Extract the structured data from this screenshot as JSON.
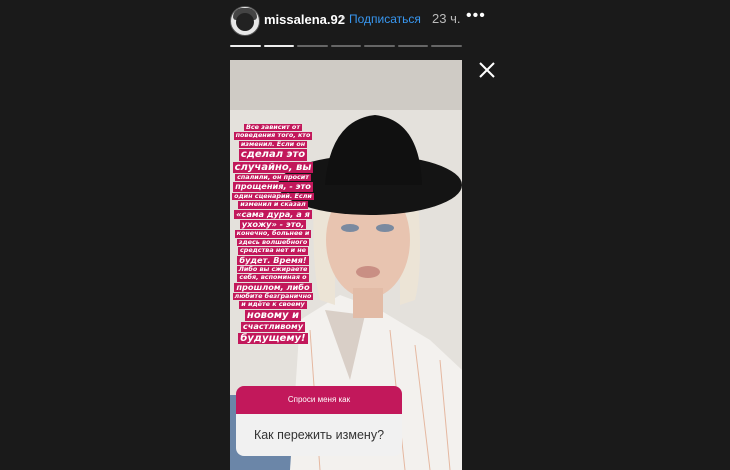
{
  "header": {
    "username": "missalena.92",
    "separator": "•",
    "subscribe_label": "Подписаться",
    "time": "23 ч.",
    "more_label": "•••"
  },
  "progress": {
    "total": 7,
    "completed": 2
  },
  "story": {
    "sticker_lines": [
      {
        "text": "Все зависит от",
        "size": "s"
      },
      {
        "text": "поведения того, кто",
        "size": "s"
      },
      {
        "text": "изменил. Если он",
        "size": "s"
      },
      {
        "text": "сделал это",
        "size": "b"
      },
      {
        "text": "случайно, вы",
        "size": "b"
      },
      {
        "text": "спалили, он просит",
        "size": "s"
      },
      {
        "text": "прощения, - это",
        "size": "m"
      },
      {
        "text": "один сценарий. Если",
        "size": "s"
      },
      {
        "text": "изменил и сказал",
        "size": "s"
      },
      {
        "text": "«сама дура, а я",
        "size": "m"
      },
      {
        "text": "ухожу» - это,",
        "size": "m"
      },
      {
        "text": "конечно, больнее и",
        "size": "s"
      },
      {
        "text": "здесь волшебного",
        "size": "s"
      },
      {
        "text": "средства нет и не",
        "size": "s"
      },
      {
        "text": "будет. Время!",
        "size": "m"
      },
      {
        "text": "Либо вы сжираете",
        "size": "s"
      },
      {
        "text": "себя, вспоминая о",
        "size": "s"
      },
      {
        "text": "прошлом, либо",
        "size": "m"
      },
      {
        "text": "любите безгранично",
        "size": "s"
      },
      {
        "text": "и идёте к своему",
        "size": "s"
      },
      {
        "text": "новому и",
        "size": "b"
      },
      {
        "text": "счастливому",
        "size": "m"
      },
      {
        "text": "будущему!",
        "size": "b"
      }
    ],
    "question_prompt": "Спроси меня как",
    "question_text": "Как пережить измену?"
  },
  "colors": {
    "accent": "#c2185b",
    "link": "#3897f0",
    "background": "#1a1a1a"
  },
  "icons": {
    "close": "close-icon",
    "more": "more-icon"
  }
}
